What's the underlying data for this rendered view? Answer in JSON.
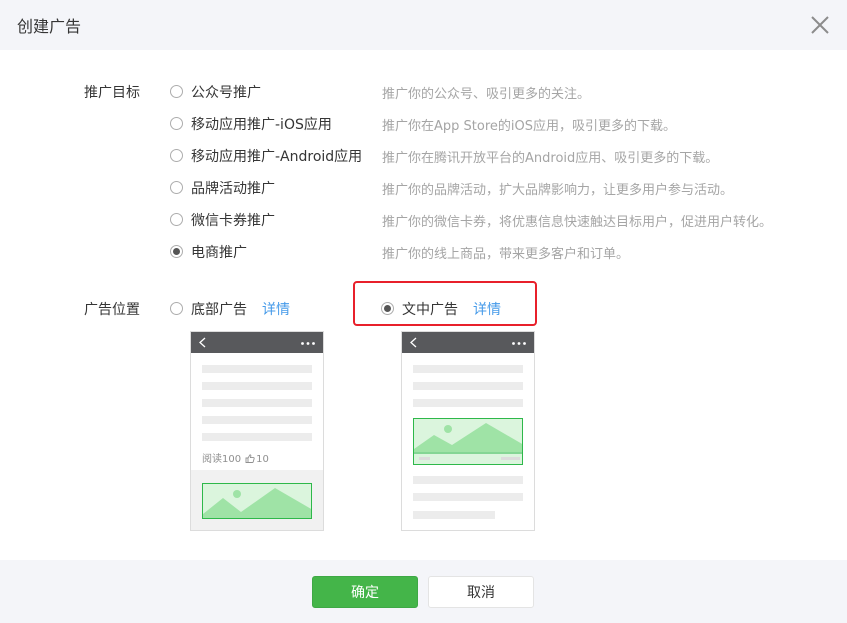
{
  "dialog": {
    "title": "创建广告",
    "close_icon": "close-icon"
  },
  "target": {
    "label": "推广目标",
    "options": [
      {
        "label": "公众号推广",
        "desc": "推广你的公众号、吸引更多的关注。",
        "checked": false
      },
      {
        "label": "移动应用推广-iOS应用",
        "desc": "推广你在App Store的iOS应用，吸引更多的下载。",
        "checked": false
      },
      {
        "label": "移动应用推广-Android应用",
        "desc": "推广你在腾讯开放平台的Android应用、吸引更多的下载。",
        "checked": false
      },
      {
        "label": "品牌活动推广",
        "desc": "推广你的品牌活动，扩大品牌影响力，让更多用户参与活动。",
        "checked": false
      },
      {
        "label": "微信卡券推广",
        "desc": "推广你的微信卡券，将优惠信息快速触达目标用户，促进用户转化。",
        "checked": false
      },
      {
        "label": "电商推广",
        "desc": "推广你的线上商品，带来更多客户和订单。",
        "checked": true
      }
    ]
  },
  "position": {
    "label": "广告位置",
    "bottom": {
      "label": "底部广告",
      "link": "详情",
      "checked": false
    },
    "inline": {
      "label": "文中广告",
      "link": "详情",
      "checked": true
    },
    "preview": {
      "reads": "阅读100",
      "likes": "10",
      "icons": [
        "back-icon",
        "more-icon",
        "thumbs-up-icon",
        "image-placeholder-icon"
      ]
    }
  },
  "footer": {
    "ok_label": "确定",
    "cancel_label": "取消"
  },
  "colors": {
    "accent_green": "#44b549",
    "link_blue": "#459ae9",
    "highlight_red": "#e8202b"
  }
}
